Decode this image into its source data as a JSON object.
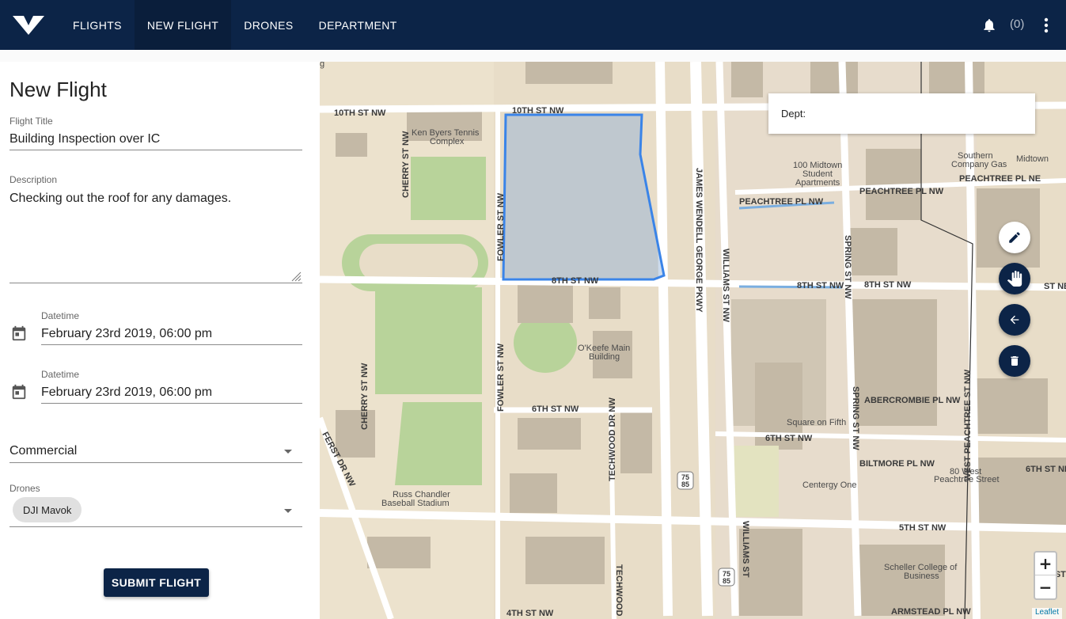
{
  "nav": {
    "items": [
      {
        "label": "FLIGHTS",
        "active": false
      },
      {
        "label": "NEW FLIGHT",
        "active": true
      },
      {
        "label": "DRONES",
        "active": false
      },
      {
        "label": "DEPARTMENT",
        "active": false
      }
    ],
    "notification_count": "(0)",
    "icons": [
      "logo-icon",
      "bell-icon",
      "more-vert-icon"
    ]
  },
  "form": {
    "title": "New Flight",
    "flight_title_label": "Flight Title",
    "flight_title_value": "Building Inspection over IC",
    "description_label": "Description",
    "description_value": "Checking out the roof for any damages.",
    "start_label": "Datetime",
    "start_value": "February 23rd 2019, 06:00 pm",
    "end_label": "Datetime",
    "end_value": "February 23rd 2019, 06:00 pm",
    "type_value": "Commercial",
    "drones_label": "Drones",
    "drone_chip": "DJI Mavok",
    "submit_label": "SUBMIT FLIGHT"
  },
  "map": {
    "dept_label": "Dept:",
    "zoom_in": "+",
    "zoom_out": "−",
    "attribution": "Leaflet",
    "tools": [
      "pencil-icon",
      "hand-icon",
      "arrow-back-icon",
      "trash-icon"
    ],
    "street_labels": {
      "s10th": "10TH ST NW",
      "s8th_a": "8TH ST NW",
      "s8th_b": "8TH ST NW",
      "s8th_c": "8TH ST NW",
      "s8th_ne": "ST NE",
      "s6th_a": "6TH ST NW",
      "s6th_b": "6TH ST NW",
      "s6th_ne": "6TH ST NE",
      "s5th": "5TH ST NW",
      "s5th_ne": "5TH ST",
      "s4th": "4TH ST NW",
      "peachtree_pl": "PEACHTREE PL NW",
      "peachtree_pl_2": "PEACHTREE PL NW",
      "peachtree_pl_ne": "PEACHTREE PL NE",
      "abercrombie": "ABERCROMBIE PL NW",
      "biltmore": "BILTMORE PL NW",
      "armstead": "ARMSTEAD PL NW",
      "cherry_a": "CHERRY ST NW",
      "cherry_b": "CHERRY ST NW",
      "fowler_a": "FOWLER ST NW",
      "fowler_b": "FOWLER ST NW",
      "james": "JAMES WENDELL GEORGE PKWY",
      "williams_a": "WILLIAMS ST NW",
      "williams_b": "WILLIAMS ST",
      "spring_a": "SPRING ST NW",
      "spring_b": "SPRING ST NW",
      "west_peachtree": "WEST PEACHTREE ST NW",
      "techwood_a": "TECHWOOD DR NW",
      "techwood_b": "TECHWOOD",
      "ferst": "FERST DR NW",
      "st_ne_a": "ST NE",
      "hwy_75": "75",
      "hwy_85": "85"
    },
    "place_labels": {
      "ken_byers_1": "Ken Byers Tennis",
      "ken_byers_2": "Complex",
      "midtown_1": "100 Midtown",
      "midtown_2": "Student",
      "midtown_3": "Apartments",
      "southern_1": "Southern",
      "southern_2": "Company Gas",
      "midtown_station": "Midtown",
      "okeefe_1": "O'Keefe Main",
      "okeefe_2": "Building",
      "square_fifth": "Square on Fifth",
      "centergy": "Centergy One",
      "west_peach_1": "80 West",
      "west_peach_2": "Peachtree Street",
      "russ_1": "Russ Chandler",
      "russ_2": "Baseball Stadium",
      "scheller_1": "Scheller College of",
      "scheller_2": "Business",
      "partial_g": "g"
    }
  }
}
